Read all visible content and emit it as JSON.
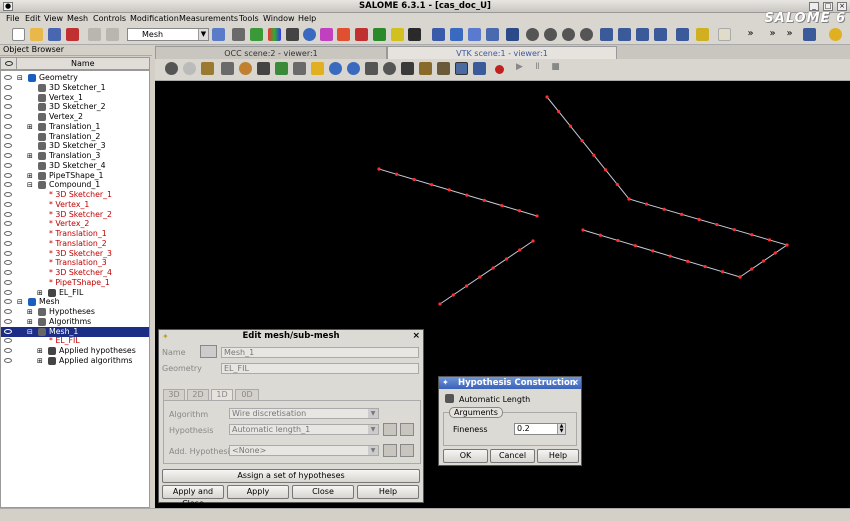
{
  "window": {
    "title": "SALOME 6.3.1 - [cas_doc_U]"
  },
  "logo": "SALOME 6",
  "menu": [
    "File",
    "Edit",
    "View",
    "Mesh",
    "Controls",
    "Modification",
    "Measurements",
    "Tools",
    "Window",
    "Help"
  ],
  "toolbar": {
    "module_combo": "Mesh"
  },
  "object_browser": {
    "title": "Object Browser",
    "column": "Name",
    "items": [
      {
        "label": "Geometry",
        "level": 0,
        "exp": "-",
        "color": "black",
        "sel": false
      },
      {
        "label": "3D Sketcher_1",
        "level": 1,
        "exp": "",
        "color": "black",
        "sel": false
      },
      {
        "label": "Vertex_1",
        "level": 1,
        "exp": "",
        "color": "black",
        "sel": false
      },
      {
        "label": "3D Sketcher_2",
        "level": 1,
        "exp": "",
        "color": "black",
        "sel": false
      },
      {
        "label": "Vertex_2",
        "level": 1,
        "exp": "",
        "color": "black",
        "sel": false
      },
      {
        "label": "Translation_1",
        "level": 1,
        "exp": "+",
        "color": "black",
        "sel": false
      },
      {
        "label": "Translation_2",
        "level": 1,
        "exp": "",
        "color": "black",
        "sel": false
      },
      {
        "label": "3D Sketcher_3",
        "level": 1,
        "exp": "",
        "color": "black",
        "sel": false
      },
      {
        "label": "Translation_3",
        "level": 1,
        "exp": "+",
        "color": "black",
        "sel": false
      },
      {
        "label": "3D Sketcher_4",
        "level": 1,
        "exp": "",
        "color": "black",
        "sel": false
      },
      {
        "label": "PipeTShape_1",
        "level": 1,
        "exp": "+",
        "color": "black",
        "sel": false
      },
      {
        "label": "Compound_1",
        "level": 1,
        "exp": "-",
        "color": "black",
        "sel": false
      },
      {
        "label": "* 3D Sketcher_1",
        "level": 2,
        "exp": "",
        "color": "red",
        "sel": false
      },
      {
        "label": "* Vertex_1",
        "level": 2,
        "exp": "",
        "color": "red",
        "sel": false
      },
      {
        "label": "* 3D Sketcher_2",
        "level": 2,
        "exp": "",
        "color": "red",
        "sel": false
      },
      {
        "label": "* Vertex_2",
        "level": 2,
        "exp": "",
        "color": "red",
        "sel": false
      },
      {
        "label": "* Translation_1",
        "level": 2,
        "exp": "",
        "color": "red",
        "sel": false
      },
      {
        "label": "* Translation_2",
        "level": 2,
        "exp": "",
        "color": "red",
        "sel": false
      },
      {
        "label": "* 3D Sketcher_3",
        "level": 2,
        "exp": "",
        "color": "red",
        "sel": false
      },
      {
        "label": "* Translation_3",
        "level": 2,
        "exp": "",
        "color": "red",
        "sel": false
      },
      {
        "label": "* 3D Sketcher_4",
        "level": 2,
        "exp": "",
        "color": "red",
        "sel": false
      },
      {
        "label": "* PipeTShape_1",
        "level": 2,
        "exp": "",
        "color": "red",
        "sel": false
      },
      {
        "label": "EL_FIL",
        "level": 2,
        "exp": "+",
        "color": "black",
        "sel": false
      },
      {
        "label": "Mesh",
        "level": 0,
        "exp": "-",
        "color": "black",
        "sel": false
      },
      {
        "label": "Hypotheses",
        "level": 1,
        "exp": "+",
        "color": "black",
        "sel": false
      },
      {
        "label": "Algorithms",
        "level": 1,
        "exp": "+",
        "color": "black",
        "sel": false
      },
      {
        "label": "Mesh_1",
        "level": 1,
        "exp": "-",
        "color": "black",
        "sel": true
      },
      {
        "label": "* EL_FIL",
        "level": 2,
        "exp": "",
        "color": "red",
        "sel": false
      },
      {
        "label": "Applied hypotheses",
        "level": 2,
        "exp": "+",
        "color": "black",
        "sel": false
      },
      {
        "label": "Applied algorithms",
        "level": 2,
        "exp": "+",
        "color": "black",
        "sel": false
      }
    ]
  },
  "viewers": {
    "tab1": "OCC scene:2 - viewer:1",
    "tab2": "VTK scene:1 - viewer:1"
  },
  "edit_mesh": {
    "title": "Edit mesh/sub-mesh",
    "name_label": "Name",
    "name_value": "Mesh_1",
    "geometry_label": "Geometry",
    "geometry_value": "EL_FIL",
    "tabs": [
      "3D",
      "2D",
      "1D",
      "0D"
    ],
    "algorithm_label": "Algorithm",
    "algorithm_value": "Wire discretisation",
    "hypothesis_label": "Hypothesis",
    "hypothesis_value": "Automatic length_1",
    "add_hyp_label": "Add. Hypothesis",
    "add_hyp_value": "<None>",
    "assign_btn": "Assign a set of hypotheses",
    "buttons": [
      "Apply and Close",
      "Apply",
      "Close",
      "Help"
    ]
  },
  "hypothesis": {
    "title": "Hypothesis Construction",
    "type": "Automatic Length",
    "group": "Arguments",
    "fineness_label": "Fineness",
    "fineness_value": "0.2",
    "buttons": [
      "OK",
      "Cancel",
      "Help"
    ]
  }
}
